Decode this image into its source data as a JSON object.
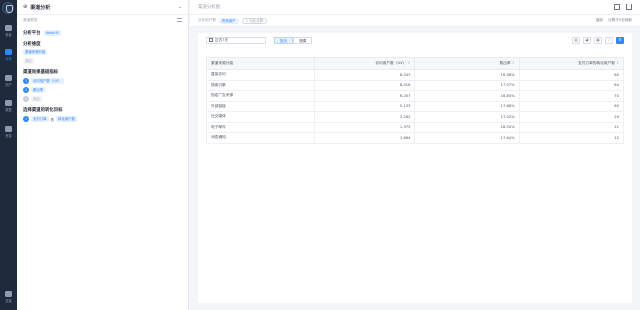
{
  "nav": {
    "items": [
      {
        "label": "看板"
      },
      {
        "label": "分析"
      },
      {
        "label": "用户"
      },
      {
        "label": "数据"
      },
      {
        "label": "资源"
      }
    ],
    "settings_label": "设置"
  },
  "sidebar": {
    "title": "渠道分析",
    "subtitle": "渠道类型",
    "platform_label": "分析平台",
    "platform_value": "Web/H5",
    "dimension_label": "分析维度",
    "dimension_value": "渠道来源分组",
    "dimension_add": "添加",
    "metrics_label": "渠道效果基础指标",
    "metrics": [
      {
        "num": "1",
        "label": "访问用户数（UV）"
      },
      {
        "num": "2",
        "label": "跳出率"
      }
    ],
    "metrics_add": "添加",
    "goal_label": "选择渠道的转化目标",
    "goal_num": "1",
    "goal_chip": "支付订单",
    "goal_of": "的",
    "goal_metric": "转化用户数"
  },
  "main": {
    "title": "渠道分析图",
    "user_group_label": "分析用户群",
    "user_group_value": "所有用户",
    "compare_label": "+ 对比分群",
    "save_label": "保存",
    "calc_label": "计算于2分钟前",
    "date_value": "过去7天",
    "segments": [
      "按天",
      "按周"
    ],
    "view_icons": [
      "bar-chart",
      "pie-chart",
      "grid",
      "line-chart",
      "table"
    ]
  },
  "table": {
    "headers": [
      "渠道来源分组",
      "访问用户数（UV）",
      "跳出率",
      "支付订单的转化用户数"
    ],
    "rows": [
      [
        "直接访问",
        "8,043",
        "16.98%",
        "80"
      ],
      [
        "搜索引擎",
        "8,018",
        "17.07%",
        "84"
      ],
      [
        "指定广告来源",
        "6,207",
        "16.85%",
        "70"
      ],
      [
        "外部链接",
        "5,133",
        "17.88%",
        "60"
      ],
      [
        "社交媒体",
        "3,262",
        "17.02%",
        "29"
      ],
      [
        "电子邮件",
        "1,975",
        "18.54%",
        "21"
      ],
      [
        "消息通知",
        "1,664",
        "17.64%",
        "12"
      ]
    ]
  },
  "colors": {
    "accent": "#2f86f6",
    "nav_bg": "#1f2a3d"
  }
}
